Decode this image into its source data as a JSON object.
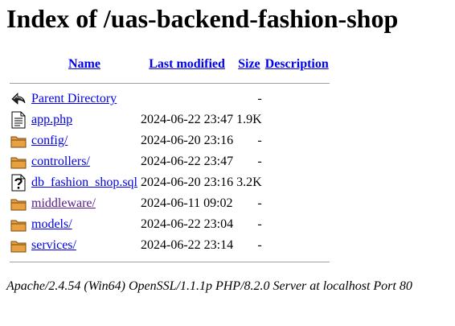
{
  "page": {
    "title": "Index of /uas-backend-fashion-shop",
    "address": "Apache/2.4.54 (Win64) OpenSSL/1.1.1p PHP/8.2.0 Server at localhost Port 80"
  },
  "columns": {
    "name": "Name",
    "last_modified": "Last modified",
    "size": "Size",
    "description": "Description"
  },
  "entries": [
    {
      "icon": "back-icon",
      "name": "Parent Directory",
      "modified": "",
      "size": "-",
      "description": ""
    },
    {
      "icon": "text-file-icon",
      "name": "app.php",
      "modified": "2024-06-22 23:47",
      "size": "1.9K",
      "description": ""
    },
    {
      "icon": "folder-icon",
      "name": "config/",
      "modified": "2024-06-20 23:16",
      "size": "-",
      "description": ""
    },
    {
      "icon": "folder-icon",
      "name": "controllers/",
      "modified": "2024-06-22 23:47",
      "size": "-",
      "description": ""
    },
    {
      "icon": "unknown-file-icon",
      "name": "db_fashion_shop.sql",
      "modified": "2024-06-20 23:16",
      "size": "3.2K",
      "description": ""
    },
    {
      "icon": "folder-icon",
      "name": "middleware/",
      "modified": "2024-06-11 09:02",
      "size": "-",
      "description": ""
    },
    {
      "icon": "folder-icon",
      "name": "models/",
      "modified": "2024-06-22 23:04",
      "size": "-",
      "description": ""
    },
    {
      "icon": "folder-icon",
      "name": "services/",
      "modified": "2024-06-22 23:14",
      "size": "-",
      "description": ""
    }
  ],
  "colors": {
    "link": "#0000EE",
    "visited": "#551A8B",
    "rule": "#a0a0a0"
  }
}
